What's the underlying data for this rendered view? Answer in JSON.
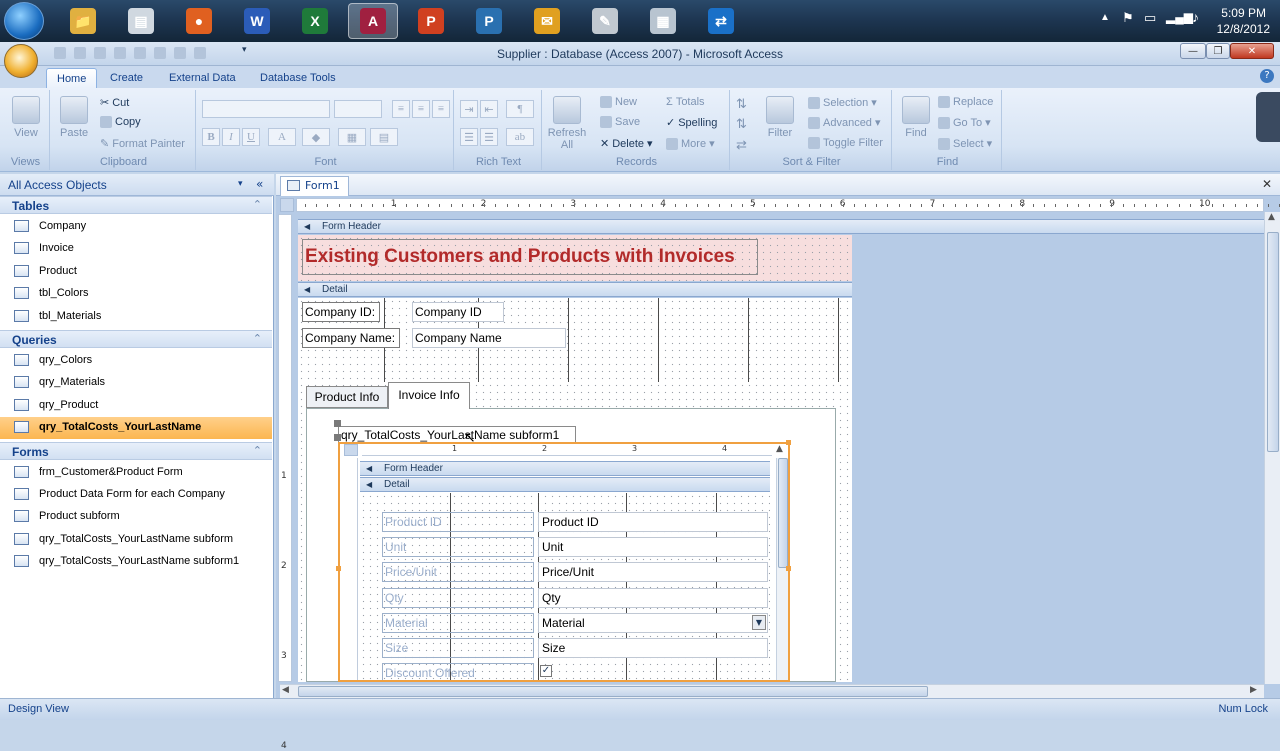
{
  "taskbar": {
    "apps": [
      {
        "icon": "windows-explorer-icon",
        "color": "#e0b040",
        "glyph": "📁"
      },
      {
        "icon": "presentation-app-icon",
        "color": "#d0d8e0",
        "glyph": "▤"
      },
      {
        "icon": "firefox-icon",
        "color": "#e06020",
        "glyph": "●"
      },
      {
        "icon": "word-icon",
        "color": "#2b5cb8",
        "glyph": "W"
      },
      {
        "icon": "excel-icon",
        "color": "#1f7a3a",
        "glyph": "X"
      },
      {
        "icon": "access-icon",
        "color": "#a02040",
        "glyph": "A"
      },
      {
        "icon": "powerpoint-icon",
        "color": "#d04020",
        "glyph": "P"
      },
      {
        "icon": "publisher-icon",
        "color": "#2a70b0",
        "glyph": "P"
      },
      {
        "icon": "outlook-icon",
        "color": "#e0a020",
        "glyph": "✉"
      },
      {
        "icon": "paint-icon",
        "color": "#c0c8d0",
        "glyph": "✎"
      },
      {
        "icon": "calculator-icon",
        "color": "#b8c4d0",
        "glyph": "▦"
      },
      {
        "icon": "teamviewer-icon",
        "color": "#1a70c8",
        "glyph": "⇄"
      }
    ],
    "time": "5:09 PM",
    "date": "12/8/2012"
  },
  "window": {
    "title": "Supplier : Database (Access 2007) - Microsoft Access"
  },
  "tabs": [
    "Home",
    "Create",
    "External Data",
    "Database Tools"
  ],
  "ribbon": {
    "views": {
      "view": "View",
      "group": "Views"
    },
    "clipboard": {
      "paste": "Paste",
      "cut": "Cut",
      "copy": "Copy",
      "format_painter": "Format Painter",
      "group": "Clipboard"
    },
    "font": {
      "group": "Font"
    },
    "rich_text": {
      "group": "Rich Text"
    },
    "records": {
      "refresh": "Refresh All",
      "new": "New",
      "save": "Save",
      "delete": "Delete",
      "totals": "Totals",
      "spelling": "Spelling",
      "more": "More",
      "group": "Records"
    },
    "sort_filter": {
      "filter": "Filter",
      "selection": "Selection",
      "advanced": "Advanced",
      "toggle_filter": "Toggle Filter",
      "group": "Sort & Filter"
    },
    "find": {
      "find": "Find",
      "replace": "Replace",
      "goto": "Go To",
      "select": "Select",
      "group": "Find"
    }
  },
  "nav": {
    "header": "All Access Objects",
    "sections": [
      {
        "title": "Tables",
        "items": [
          "Company",
          "Invoice",
          "Product",
          "tbl_Colors",
          "tbl_Materials"
        ]
      },
      {
        "title": "Queries",
        "items": [
          "qry_Colors",
          "qry_Materials",
          "qry_Product",
          "qry_TotalCosts_YourLastName"
        ]
      },
      {
        "title": "Forms",
        "items": [
          "frm_Customer&Product Form",
          "Product Data Form for each Company",
          "Product subform",
          "qry_TotalCosts_YourLastName subform",
          "qry_TotalCosts_YourLastName subform1"
        ]
      }
    ]
  },
  "document": {
    "tab": "Form1",
    "form_header_band": "Form Header",
    "detail_band": "Detail",
    "title": "Existing Customers and Products with Invoices",
    "title_color": "#b22a2a",
    "company_id_label": "Company ID:",
    "company_id_box": "Company ID",
    "company_name_label": "Company Name:",
    "company_name_box": "Company Name",
    "tab_product_info": "Product Info",
    "tab_invoice_info": "Invoice Info",
    "subform_label": "qry_TotalCosts_YourLastName subform1",
    "sub_form_header": "Form Header",
    "sub_detail": "Detail",
    "sub_fields": [
      {
        "label": "Product ID",
        "box": "Product ID"
      },
      {
        "label": "Unit",
        "box": "Unit"
      },
      {
        "label": "Price/Unit",
        "box": "Price/Unit"
      },
      {
        "label": "Qty",
        "box": "Qty"
      },
      {
        "label": "Material",
        "box": "Material"
      },
      {
        "label": "Size",
        "box": "Size"
      },
      {
        "label": "Discount Offered",
        "box": ""
      }
    ],
    "ruler_numbers": [
      "1",
      "2",
      "3",
      "4",
      "5",
      "6",
      "7",
      "8",
      "9",
      "10"
    ],
    "sub_ruler_numbers": [
      "1",
      "2",
      "3",
      "4"
    ],
    "vruler_numbers": [
      "1",
      "2",
      "3",
      "4"
    ]
  },
  "status": {
    "left": "Design View",
    "right": "Num Lock"
  }
}
